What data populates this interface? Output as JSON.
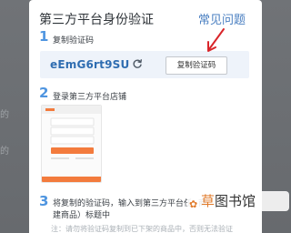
{
  "background": {
    "fragment_1": "的",
    "fragment_2": "的"
  },
  "dialog": {
    "title": "第三方平台身份验证",
    "help_link": "常见问题",
    "steps": [
      {
        "number": "1",
        "text": "复制验证码"
      },
      {
        "number": "2",
        "text": "登录第三方平台店铺"
      },
      {
        "number": "3",
        "text_line1": "将复制的验证码，输入到第三方平台任",
        "text_line1_tail": "商",
        "text_line2": "建商品）标题中"
      }
    ],
    "verification_code": "eEmG6rt9SU",
    "copy_button_label": "复制验证码",
    "note": "注：请勿将验证码复制到已下架的商品中，否则无法验证"
  },
  "colors": {
    "accent": "#4f95e0",
    "code_text": "#2f6db1",
    "arrow": "#d9252a",
    "thumbnail_accent": "#f37b3d"
  },
  "watermark": {
    "accent_text": "草",
    "rest_text": "图书馆"
  }
}
